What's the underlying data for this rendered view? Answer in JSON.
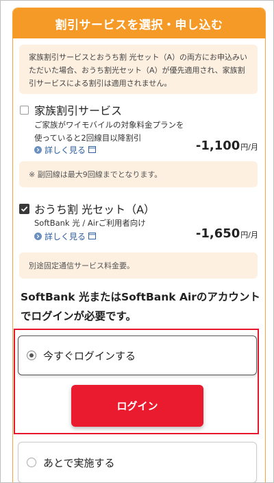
{
  "header": {
    "title": "割引サービスを選択・申し込む"
  },
  "notice": {
    "text": "家族割引サービスとおうち割 光セット（A）の両方にお申込みいただいた場合、おうち割光セット（A）が優先適用され、家族割引サービスによる割引は適用されません。"
  },
  "options": [
    {
      "title": "家族割引サービス",
      "checked": false,
      "desc_line1": "ご家族がワイモバイルの対象料金プランを",
      "desc_line2": "使っていると2回線目以降割引",
      "more_label": "詳しく見る",
      "price": "-1,100",
      "unit": "円/月",
      "note": "※ 副回線は最大9回線までとなります。"
    },
    {
      "title": "おうち割 光セット（A）",
      "checked": true,
      "desc_line1": "SoftBank 光 / Airご利用者向け",
      "more_label": "詳しく見る",
      "price": "-1,650",
      "unit": "円/月",
      "note": "別途固定通信サービス料金要。"
    }
  ],
  "login": {
    "heading": "SoftBank 光またはSoftBank Airのアカウントでログインが必要です。",
    "choice_now": "今すぐログインする",
    "button_label": "ログイン",
    "choice_later": "あとで実施する"
  },
  "colors": {
    "accent_orange": "#f59a26",
    "note_bg": "#fdf0e1",
    "login_red": "#ea1a2f",
    "link_blue": "#2f5fa0"
  }
}
